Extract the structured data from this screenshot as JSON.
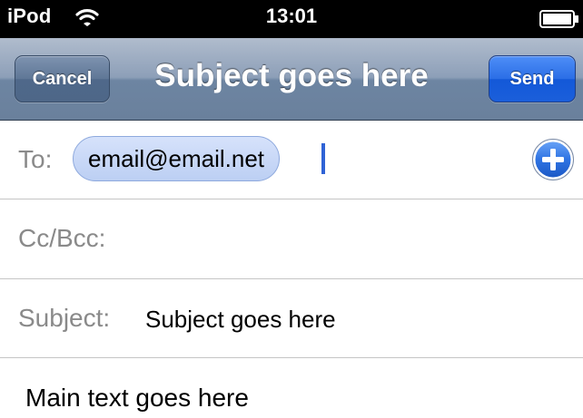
{
  "status_bar": {
    "device": "iPod",
    "time": "13:01",
    "icons": [
      "wifi-icon",
      "battery-icon"
    ]
  },
  "nav_bar": {
    "cancel_label": "Cancel",
    "title": "Subject goes here",
    "send_label": "Send"
  },
  "fields": {
    "to_label": "To:",
    "recipient": "email@email.net",
    "add_icon": "add-contact-icon",
    "cc_label": "Cc/Bcc:",
    "subject_label": "Subject:",
    "subject_value": "Subject goes here"
  },
  "body": {
    "text": "Main text goes here"
  },
  "colors": {
    "nav_bar": "#8d9fb8",
    "send_button": "#2b6ee6",
    "cancel_button": "#5f7797",
    "chip_fill": "#c9d8f7",
    "cursor": "#2f63d6"
  }
}
